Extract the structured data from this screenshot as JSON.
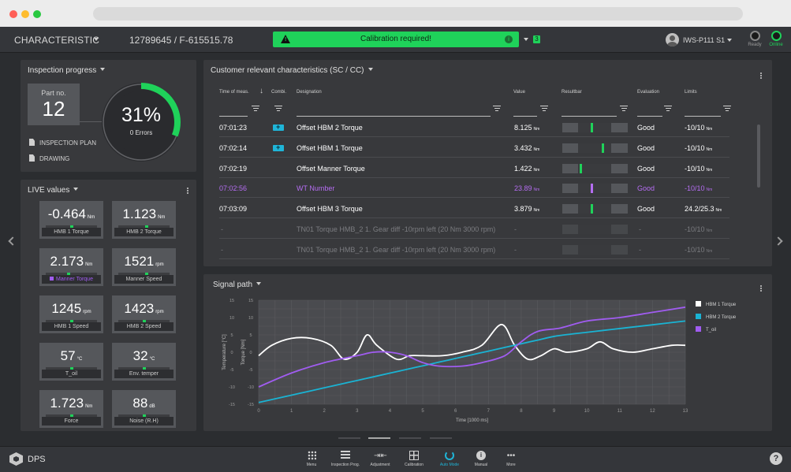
{
  "header": {
    "title": "CHARACTERISTIC",
    "id": "12789645 / F-615515.78",
    "banner": "Calibration required!",
    "banner_count": "3",
    "user": "IWS-P111 S1",
    "status_ready": "Ready",
    "status_online": "Online"
  },
  "inspection": {
    "title": "Inspection progress",
    "part_label": "Part no.",
    "part_no": "12",
    "percent": "31%",
    "percent_value": 0.31,
    "errors": "0 Errors",
    "link_plan": "INSPECTION PLAN",
    "link_drawing": "DRAWING"
  },
  "live": {
    "title": "LIVE values",
    "tiles": [
      {
        "value": "-0.464",
        "unit": "Nm",
        "label": "HMB 1 Torque",
        "marker": 0.5,
        "accent": false
      },
      {
        "value": "1.123",
        "unit": "Nm",
        "label": "HMB 2 Torque",
        "marker": 0.55,
        "accent": false
      },
      {
        "value": "2.173",
        "unit": "Nm",
        "label": "Manner Torque",
        "marker": 0.45,
        "accent": true
      },
      {
        "value": "1521",
        "unit": "rpm",
        "label": "Manner Speed",
        "marker": 0.55,
        "accent": false
      },
      {
        "value": "1245",
        "unit": "rpm",
        "label": "HMB 1 Speed",
        "marker": 0.5,
        "accent": false
      },
      {
        "value": "1423",
        "unit": "rpm",
        "label": "HMB 2 Speed",
        "marker": 0.5,
        "accent": false
      },
      {
        "value": "57",
        "unit": "°C",
        "label": "T_oil",
        "marker": 0.5,
        "accent": false
      },
      {
        "value": "32",
        "unit": "°C",
        "label": "Env. temper",
        "marker": 0.5,
        "accent": false
      },
      {
        "value": "1.723",
        "unit": "Nm",
        "label": "Force",
        "marker": 0.5,
        "accent": false
      },
      {
        "value": "88",
        "unit": "dB",
        "label": "Noise (R.H)",
        "marker": 0.5,
        "accent": false
      }
    ]
  },
  "characteristics": {
    "title": "Customer relevant characteristics (SC / CC)",
    "columns": {
      "time": "Time of meas.",
      "combi": "Combi.",
      "designation": "Designation",
      "value": "Value",
      "resultbar": "Resultbar",
      "evaluation": "Evaluation",
      "limits": "Limits"
    },
    "rows": [
      {
        "time": "07:01:23",
        "combi": true,
        "designation": "Offset HBM 2 Torque",
        "value": "8.125",
        "unit": "Nm",
        "marker": 0.45,
        "evaluation": "Good",
        "limits": "-10/10",
        "limits_unit": "Nm",
        "highlight": false
      },
      {
        "time": "07:02:14",
        "combi": true,
        "designation": "Offset HBM 1 Torque",
        "value": "3.432",
        "unit": "Nm",
        "marker": 0.62,
        "evaluation": "Good",
        "limits": "-10/10",
        "limits_unit": "Nm",
        "highlight": false
      },
      {
        "time": "07:02:19",
        "combi": false,
        "designation": "Offset Manner Torque",
        "value": "1.422",
        "unit": "Nm",
        "marker": 0.28,
        "evaluation": "Good",
        "limits": "-10/10",
        "limits_unit": "Nm",
        "highlight": false
      },
      {
        "time": "07:02:56",
        "combi": false,
        "designation": "WT Number",
        "value": "23.89",
        "unit": "Nm",
        "marker": 0.45,
        "evaluation": "Good",
        "limits": "-10/10",
        "limits_unit": "Nm",
        "highlight": true
      },
      {
        "time": "07:03:09",
        "combi": false,
        "designation": "Offset HBM 3 Torque",
        "value": "3.879",
        "unit": "Nm",
        "marker": 0.45,
        "evaluation": "Good",
        "limits": "24.2/25.3",
        "limits_unit": "Nm",
        "highlight": false
      }
    ],
    "pending_rows": [
      {
        "dash": "-",
        "designation": "TN01 Torque HMB_2 1. Gear diff -10rpm left (20 Nm 3000 rpm)",
        "limits": "-10/10",
        "limits_unit": "Nm"
      },
      {
        "dash": "-",
        "designation": "TN01 Torque HMB_2 1. Gear diff -10rpm left (20 Nm 3000 rpm)",
        "limits": "-10/10",
        "limits_unit": "Nm"
      }
    ]
  },
  "signal": {
    "title": "Signal path"
  },
  "chart_data": {
    "type": "line",
    "xlabel": "Time [1000 ms]",
    "ylabel_left": "Temperature [°C]",
    "ylabel_right": "Torque [Nm]",
    "xlim": [
      0,
      13
    ],
    "ylim": [
      -15,
      15
    ],
    "x_ticks": [
      "0",
      "1",
      "2",
      "3",
      "4",
      "5",
      "6",
      "7",
      "8",
      "9",
      "10",
      "11",
      "12",
      "13"
    ],
    "y_ticks": [
      "15",
      "10",
      "5",
      "0",
      "-5",
      "-10",
      "-15"
    ],
    "grid": true,
    "legend": "right",
    "series": [
      {
        "name": "HBM 1 Torque",
        "color": "#ffffff",
        "x": [
          0,
          0.4,
          1,
          1.6,
          2.2,
          2.6,
          3.0,
          3.3,
          3.6,
          4.2,
          4.6,
          5.0,
          5.6,
          6.2,
          6.8,
          7.4,
          7.8,
          8.2,
          8.6,
          9.0,
          9.4,
          10.0,
          10.4,
          10.8,
          11.4,
          12.0,
          12.6,
          13.0
        ],
        "y": [
          -1,
          2,
          4,
          4,
          2,
          -2,
          0,
          5,
          2,
          -2,
          -1,
          -1,
          -1,
          0,
          2,
          8,
          2,
          -2,
          -1,
          1,
          0,
          1,
          3,
          1,
          0,
          1,
          2,
          2
        ]
      },
      {
        "name": "HBM 2 Torque",
        "color": "#1ab3d3",
        "x": [
          0,
          13
        ],
        "y": [
          -14.5,
          9
        ]
      },
      {
        "name": "T_oil",
        "color": "#a05cf0",
        "x": [
          0,
          1,
          2,
          3,
          3.5,
          4,
          4.5,
          5.0,
          5.5,
          6.2,
          6.8,
          7.5,
          8.0,
          8.5,
          9.2,
          10.0,
          11.0,
          12.0,
          13.0
        ],
        "y": [
          -10,
          -6,
          -3,
          -1,
          0,
          0,
          -1,
          -3,
          -4,
          -4,
          -3,
          -1,
          3,
          6,
          7,
          9,
          10,
          11.5,
          13
        ]
      }
    ]
  },
  "bottom": {
    "brand": "DPS",
    "nav": [
      "Menu",
      "Inspection Prog.",
      "Adjustment",
      "Calibration",
      "Auto Mode",
      "Manual",
      "More"
    ]
  }
}
